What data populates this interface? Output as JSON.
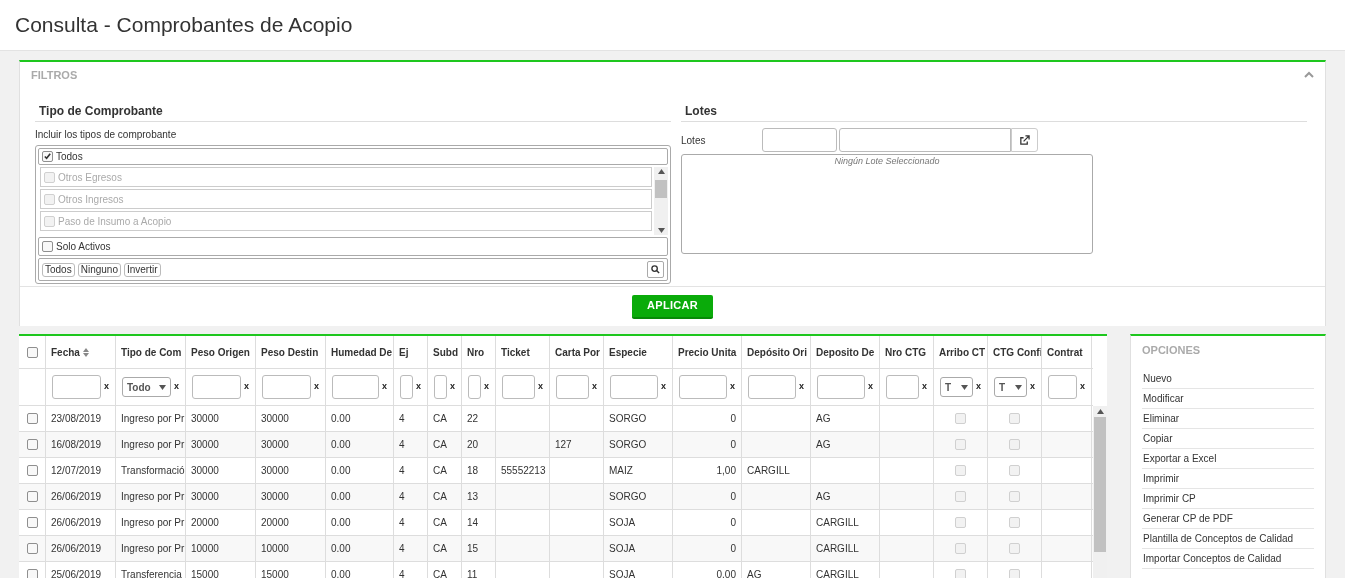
{
  "page_title": "Consulta - Comprobantes de Acopio",
  "filters": {
    "title": "FILTROS",
    "expanded": true,
    "tipo": {
      "title": "Tipo de Comprobante",
      "hint": "Incluir los tipos de comprobante",
      "all_item": {
        "label": "Todos",
        "checked": true
      },
      "items": [
        {
          "label": "Otros Egresos",
          "checked": false,
          "disabled": true
        },
        {
          "label": "Otros Ingresos",
          "checked": false,
          "disabled": true
        },
        {
          "label": "Paso de Insumo a Acopio",
          "checked": false,
          "disabled": true
        }
      ],
      "solo_activos": {
        "label": "Solo Activos",
        "checked": false
      },
      "buttons": [
        "Todos",
        "Ninguno",
        "Invertir"
      ]
    },
    "lotes": {
      "title": "Lotes",
      "label": "Lotes",
      "empty_text": "Ningún Lote Seleccionado"
    },
    "apply": "APLICAR"
  },
  "table": {
    "all_selected": false,
    "columns": [
      {
        "label": "Fecha",
        "kind": "text",
        "sortable": true,
        "filter": {
          "kind": "text",
          "clear": "x"
        }
      },
      {
        "label": "Tipo de Com",
        "kind": "text",
        "filter": {
          "kind": "select",
          "value": "Todo",
          "clear": "x"
        }
      },
      {
        "label": "Peso Origen",
        "kind": "text",
        "filter": {
          "kind": "text",
          "clear": "x"
        }
      },
      {
        "label": "Peso Destin",
        "kind": "text",
        "filter": {
          "kind": "text",
          "clear": "x"
        }
      },
      {
        "label": "Humedad De",
        "kind": "text",
        "filter": {
          "kind": "text",
          "clear": "x"
        }
      },
      {
        "label": "Ej",
        "kind": "text",
        "filter": {
          "kind": "text",
          "clear": "x"
        }
      },
      {
        "label": "Subd",
        "kind": "text",
        "filter": {
          "kind": "text",
          "clear": "x"
        }
      },
      {
        "label": "Nro",
        "kind": "text",
        "filter": {
          "kind": "text",
          "clear": "x"
        }
      },
      {
        "label": "Ticket",
        "kind": "text",
        "filter": {
          "kind": "text",
          "clear": "x"
        }
      },
      {
        "label": "Carta Por",
        "kind": "text",
        "filter": {
          "kind": "text",
          "clear": "x"
        }
      },
      {
        "label": "Especie",
        "kind": "text",
        "filter": {
          "kind": "text",
          "clear": "x"
        }
      },
      {
        "label": "Precio Unita",
        "kind": "number",
        "filter": {
          "kind": "text",
          "clear": "x"
        }
      },
      {
        "label": "Depósito Ori",
        "kind": "text",
        "filter": {
          "kind": "text",
          "clear": "x"
        }
      },
      {
        "label": "Deposito De",
        "kind": "text",
        "filter": {
          "kind": "text",
          "clear": "x"
        }
      },
      {
        "label": "Nro CTG",
        "kind": "text",
        "filter": {
          "kind": "text",
          "clear": "x"
        }
      },
      {
        "label": "Arribo CT",
        "kind": "check",
        "filter": {
          "kind": "select",
          "value": "T",
          "clear": "x"
        }
      },
      {
        "label": "CTG Confi",
        "kind": "check",
        "filter": {
          "kind": "select",
          "value": "T",
          "clear": "x"
        }
      },
      {
        "label": "Contrat",
        "kind": "text",
        "filter": {
          "kind": "text",
          "clear": "x"
        }
      }
    ],
    "rows": [
      {
        "selected": false,
        "cells": [
          "23/08/2019",
          "Ingreso por Pr",
          "30000",
          "30000",
          "0.00",
          "4",
          "CA",
          "22",
          null,
          null,
          "SORGO",
          "0",
          null,
          "AG",
          null,
          false,
          false,
          null
        ]
      },
      {
        "selected": false,
        "cells": [
          "16/08/2019",
          "Ingreso por Pr",
          "30000",
          "30000",
          "0.00",
          "4",
          "CA",
          "20",
          null,
          "127",
          "SORGO",
          "0",
          null,
          "AG",
          null,
          false,
          false,
          null
        ]
      },
      {
        "selected": false,
        "cells": [
          "12/07/2019",
          "Transformació",
          "30000",
          "30000",
          "0.00",
          "4",
          "CA",
          "18",
          "55552213",
          null,
          "MAIZ",
          "1,00",
          "CARGILL",
          null,
          null,
          false,
          false,
          null
        ]
      },
      {
        "selected": false,
        "cells": [
          "26/06/2019",
          "Ingreso por Pr",
          "30000",
          "30000",
          "0.00",
          "4",
          "CA",
          "13",
          null,
          null,
          "SORGO",
          "0",
          null,
          "AG",
          null,
          false,
          false,
          null
        ]
      },
      {
        "selected": false,
        "cells": [
          "26/06/2019",
          "Ingreso por Pr",
          "20000",
          "20000",
          "0.00",
          "4",
          "CA",
          "14",
          null,
          null,
          "SOJA",
          "0",
          null,
          "CARGILL",
          null,
          false,
          false,
          null
        ]
      },
      {
        "selected": false,
        "cells": [
          "26/06/2019",
          "Ingreso por Pr",
          "10000",
          "10000",
          "0.00",
          "4",
          "CA",
          "15",
          null,
          null,
          "SOJA",
          "0",
          null,
          "CARGILL",
          null,
          false,
          false,
          null
        ]
      },
      {
        "selected": false,
        "cells": [
          "25/06/2019",
          "Transferencia",
          "15000",
          "15000",
          "0.00",
          "4",
          "CA",
          "11",
          null,
          null,
          "SOJA",
          "0.00",
          "AG",
          "CARGILL",
          null,
          false,
          false,
          null
        ]
      }
    ]
  },
  "options": {
    "title": "OPCIONES",
    "items": [
      "Nuevo",
      "Modificar",
      "Eliminar",
      "Copiar",
      "Exportar a Excel",
      "Imprimir",
      "Imprimir CP",
      "Generar CP de PDF",
      "Plantilla de Conceptos de Calidad",
      "Importar Conceptos de Calidad"
    ]
  }
}
